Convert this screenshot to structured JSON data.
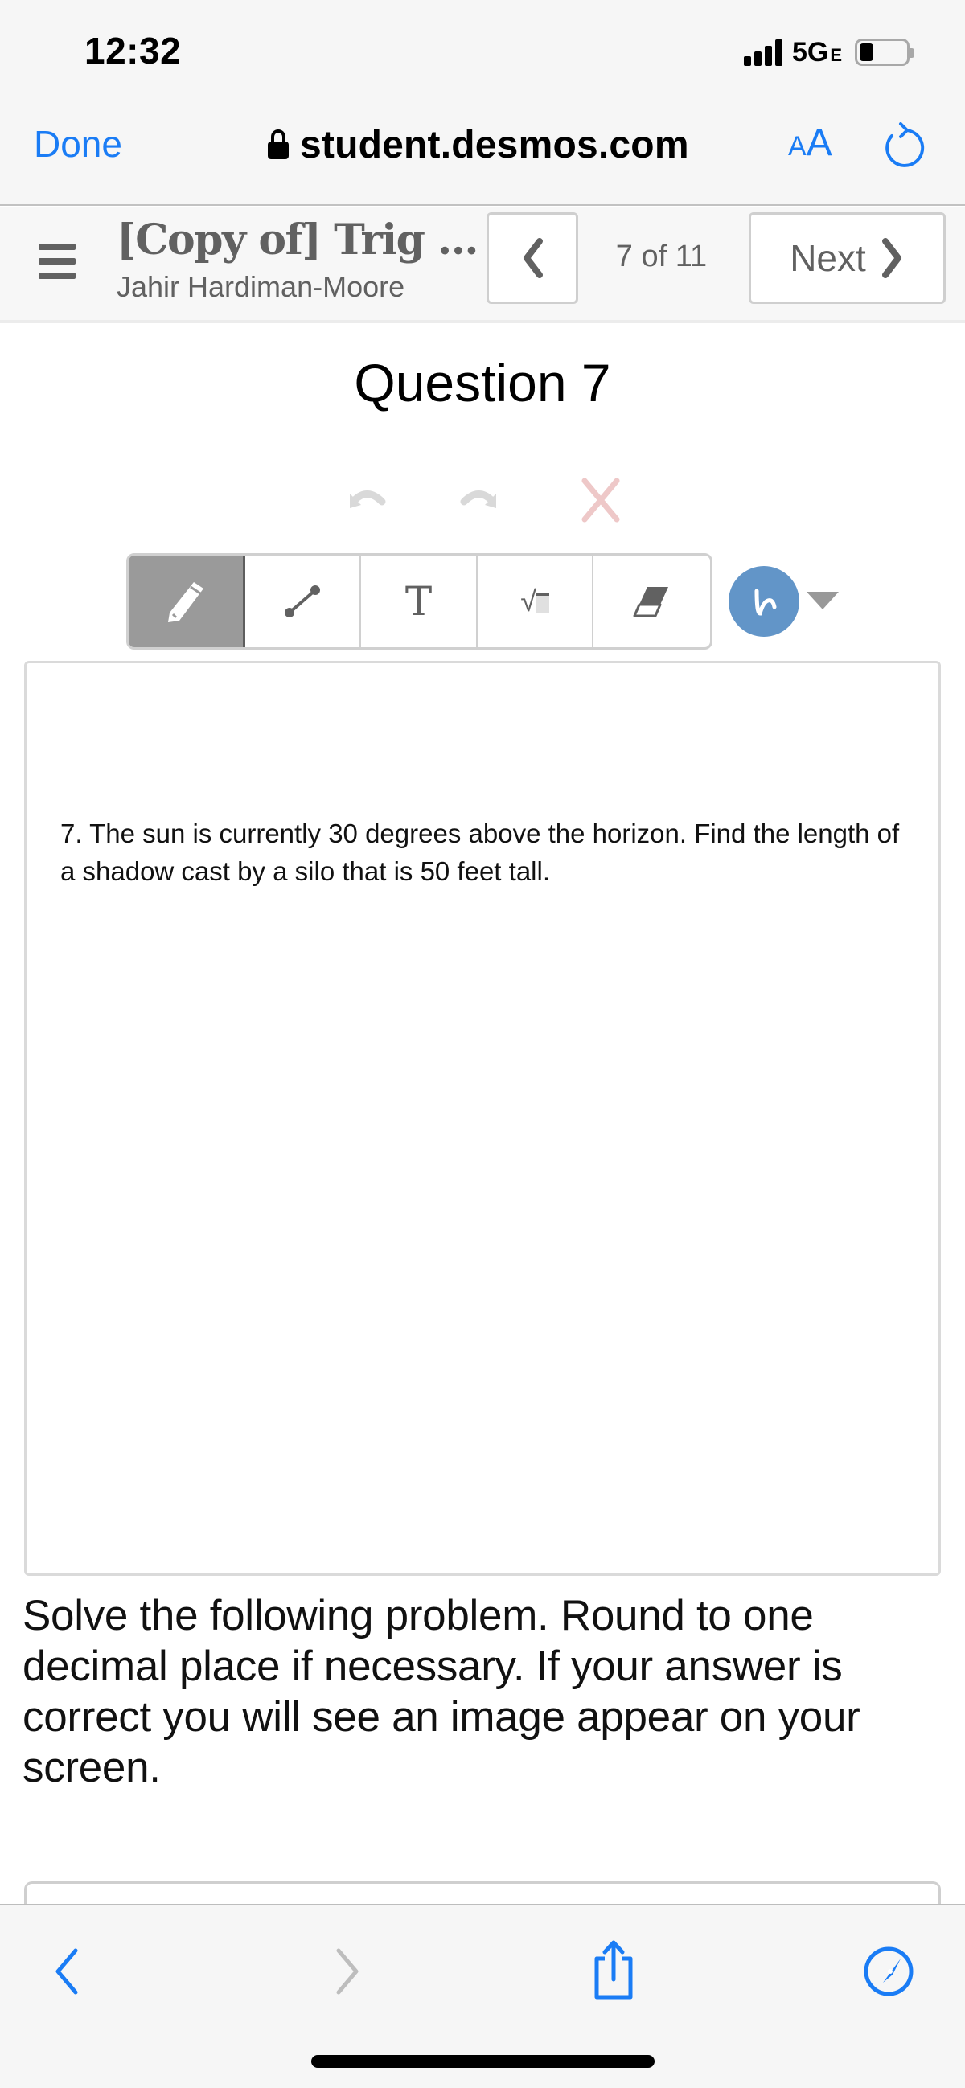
{
  "status_bar": {
    "time": "12:32",
    "network": "5G",
    "network_suffix": "E",
    "signal_bars": 4,
    "battery_level": 0.3
  },
  "browser": {
    "done_label": "Done",
    "url": "student.desmos.com",
    "text_size_label_small": "A",
    "text_size_label_large": "A"
  },
  "app_header": {
    "activity_title": "[Copy of] Trig ...",
    "teacher_name": "Jahir Hardiman-Moore",
    "page_indicator": "7 of 11",
    "next_label": "Next"
  },
  "question": {
    "title": "Question 7",
    "prompt": "7. The sun is currently 30 degrees above the horizon. Find the length of a shadow cast by a silo that is 50 feet tall.",
    "instructions": "Solve the following problem. Round to one decimal place if necessary. If your answer is correct you will see an image appear on your screen."
  },
  "sketch": {
    "tools": [
      {
        "name": "pencil",
        "active": true
      },
      {
        "name": "line",
        "active": false
      },
      {
        "name": "text",
        "active": false
      },
      {
        "name": "math",
        "active": false
      },
      {
        "name": "eraser",
        "active": false
      }
    ],
    "text_tool_glyph": "T",
    "math_tool_glyph": "√",
    "selected_color": "#6295c8",
    "undo_enabled": false,
    "redo_enabled": false
  },
  "colors": {
    "ios_blue": "#1a7cf5",
    "desmos_gray": "#616161",
    "active_tool_bg": "#9a9a9a",
    "clear_red": "#eec8c8"
  }
}
